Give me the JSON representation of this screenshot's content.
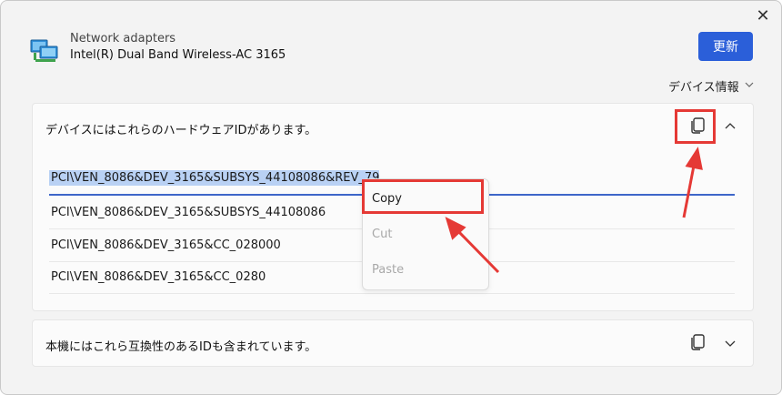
{
  "window": {
    "close_glyph": "✕"
  },
  "device": {
    "category": "Network adapters",
    "name": "Intel(R) Dual Band Wireless-AC 3165",
    "icon": "network-adapter-icon"
  },
  "buttons": {
    "update_label": "更新",
    "device_info_label": "デバイス情報"
  },
  "hardware_ids": {
    "title": "デバイスにはこれらのハードウェアIDがあります。",
    "items": [
      "PCI\\VEN_8086&DEV_3165&SUBSYS_44108086&REV_79",
      "PCI\\VEN_8086&DEV_3165&SUBSYS_44108086",
      "PCI\\VEN_8086&DEV_3165&CC_028000",
      "PCI\\VEN_8086&DEV_3165&CC_0280"
    ]
  },
  "compatible_ids": {
    "title": "本機にはこれら互換性のあるIDも含まれています。"
  },
  "context_menu": {
    "items": [
      {
        "label": "Copy",
        "enabled": true
      },
      {
        "label": "Cut",
        "enabled": false
      },
      {
        "label": "Paste",
        "enabled": false
      }
    ]
  },
  "colors": {
    "accent": "#2b5fd9",
    "selection": "#b9d1f4",
    "annotation": "#e53935"
  }
}
